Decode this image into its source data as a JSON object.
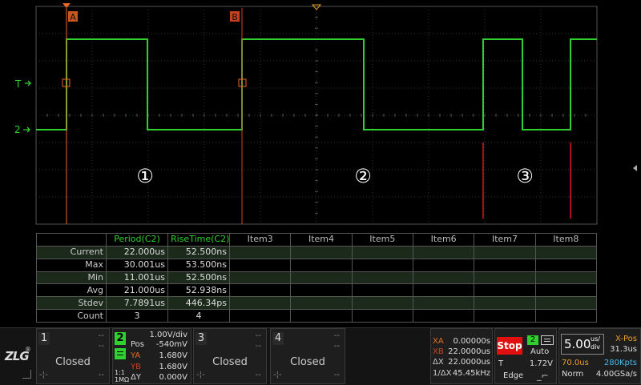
{
  "markers": {
    "cursor_a": "A",
    "cursor_b": "B",
    "trigger_level": "T",
    "ch2_marker": "2"
  },
  "annotations": [
    "①",
    "②",
    "③"
  ],
  "measure_table": {
    "headers": [
      "",
      "Period(C2)",
      "RiseTime(C2)",
      "Item3",
      "Item4",
      "Item5",
      "Item6",
      "Item7",
      "Item8"
    ],
    "rows": [
      {
        "label": "Current",
        "period": "22.000us",
        "rise": "52.500ns"
      },
      {
        "label": "Max",
        "period": "30.001us",
        "rise": "53.500ns"
      },
      {
        "label": "Min",
        "period": "11.001us",
        "rise": "52.500ns"
      },
      {
        "label": "Avg",
        "period": "21.000us",
        "rise": "52.938ns"
      },
      {
        "label": "Stdev",
        "period": "7.7891us",
        "rise": "446.34ps"
      },
      {
        "label": "Count",
        "period": "3",
        "rise": "4"
      }
    ]
  },
  "channels": {
    "ch1": {
      "num": "1",
      "status": "Closed",
      "dash": "--"
    },
    "ch2": {
      "num": "2",
      "scale": "1.00V/div",
      "pos_label": "Pos",
      "pos": "-540mV",
      "ya_label": "YA",
      "ya": "1.680V",
      "yb_label": "YB",
      "yb": "1.680V",
      "dy_label": "ΔY",
      "dy": "0.000V",
      "coupling": "1:1",
      "impedance": "1MΩ"
    },
    "ch3": {
      "num": "3",
      "status": "Closed",
      "dash": "--"
    },
    "ch4": {
      "num": "4",
      "status": "Closed",
      "dash": "--"
    }
  },
  "cursor_readout": {
    "xa_label": "XA",
    "xa": "0.00000s",
    "xb_label": "XB",
    "xb": "22.0000us",
    "dx_label": "ΔX",
    "dx": "22.0000us",
    "inv_label": "1/ΔX",
    "inv": "45.45kHz"
  },
  "run": {
    "state": "Stop",
    "trig_source": "2",
    "mode": "Auto",
    "t_label": "T",
    "level": "1.72V",
    "type": "Edge"
  },
  "timebase": {
    "scale": "5.00",
    "unit_top": "us/",
    "unit_bottom": "div",
    "xpos_label": "X-Pos",
    "xpos": "31.3us",
    "delay": "70.0us",
    "memory": "280Kpts",
    "acq": "Norm",
    "rate": "4.00GSa/s"
  },
  "logo": "ZLG",
  "colors": {
    "trace": "#2fd02f",
    "cursor": "#e8692a",
    "cursor_b": "#d04020",
    "grid": "#3a3a3a",
    "stop": "#e01010",
    "highlight": "#2fd02f"
  }
}
